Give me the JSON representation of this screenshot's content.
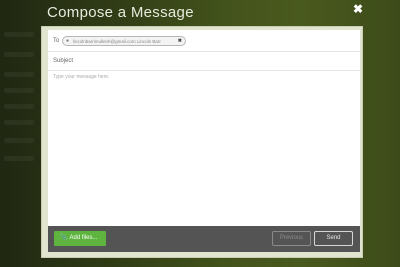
{
  "modal": {
    "title": "Compose a Message",
    "close_icon": "close-icon"
  },
  "recipient": {
    "label": "To",
    "chip_text": "lincolnbarrimullenh@gmail.com Lincoln Barr",
    "user_icon": "user-icon",
    "remove_icon": "remove-icon"
  },
  "subject": {
    "label": "Subject"
  },
  "message": {
    "placeholder": "Type your message here."
  },
  "footer": {
    "add_files_label": "Add files...",
    "previous_label": "Previous",
    "send_label": "Send",
    "add_files_color": "#5eb43f"
  }
}
